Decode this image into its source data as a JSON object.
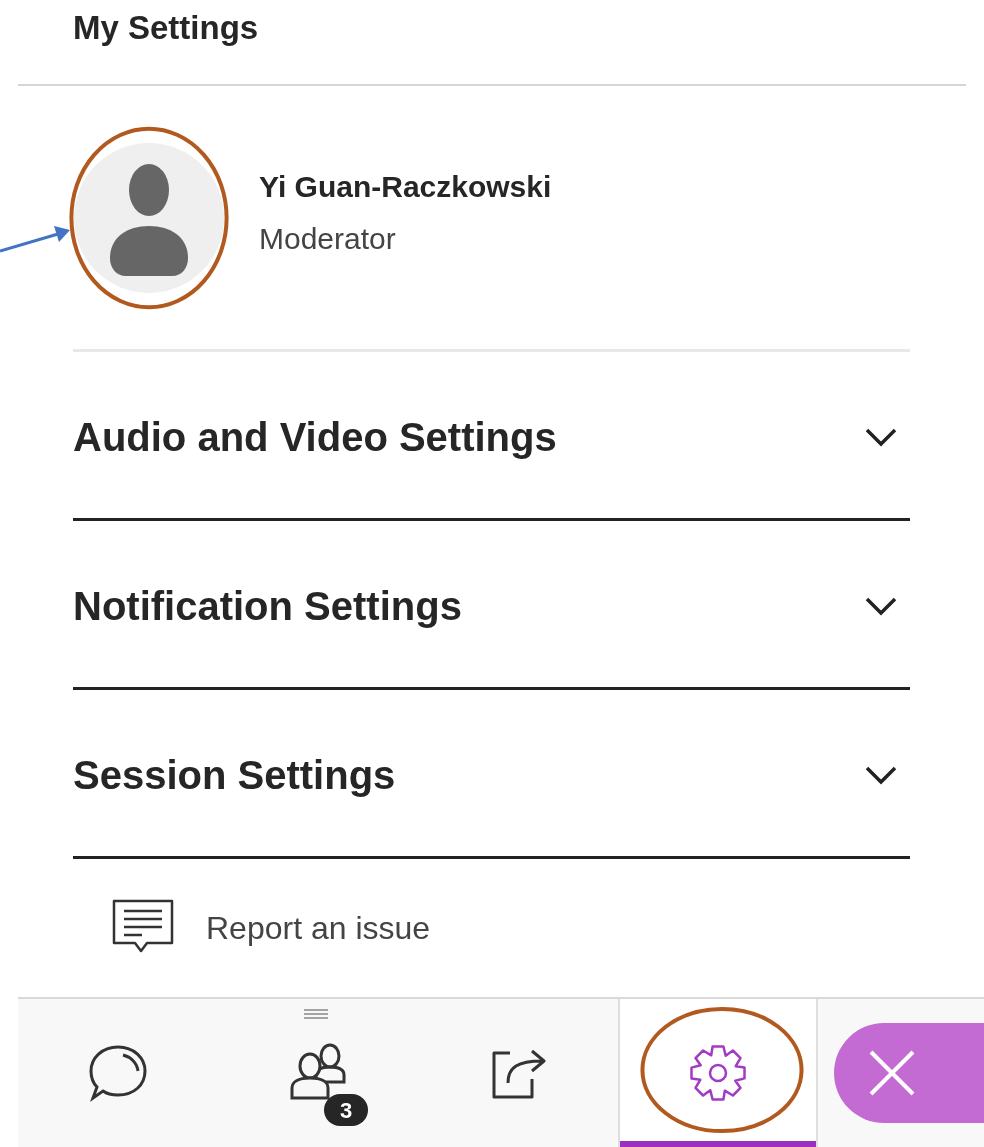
{
  "header": {
    "title": "My Settings"
  },
  "profile": {
    "name": "Yi Guan-Raczkowski",
    "role": "Moderator",
    "annotated": true
  },
  "sections": [
    {
      "title": "Audio and Video Settings",
      "expanded": false
    },
    {
      "title": "Notification Settings",
      "expanded": false
    },
    {
      "title": "Session Settings",
      "expanded": false
    }
  ],
  "report": {
    "label": "Report an issue"
  },
  "tabs": [
    {
      "kind": "chat",
      "selected": false,
      "annotated": false
    },
    {
      "kind": "attendees",
      "selected": false,
      "badge": "3",
      "annotated": false
    },
    {
      "kind": "share",
      "selected": false,
      "annotated": false
    },
    {
      "kind": "settings",
      "selected": true,
      "annotated": true
    }
  ],
  "close_button": {
    "kind": "close"
  }
}
